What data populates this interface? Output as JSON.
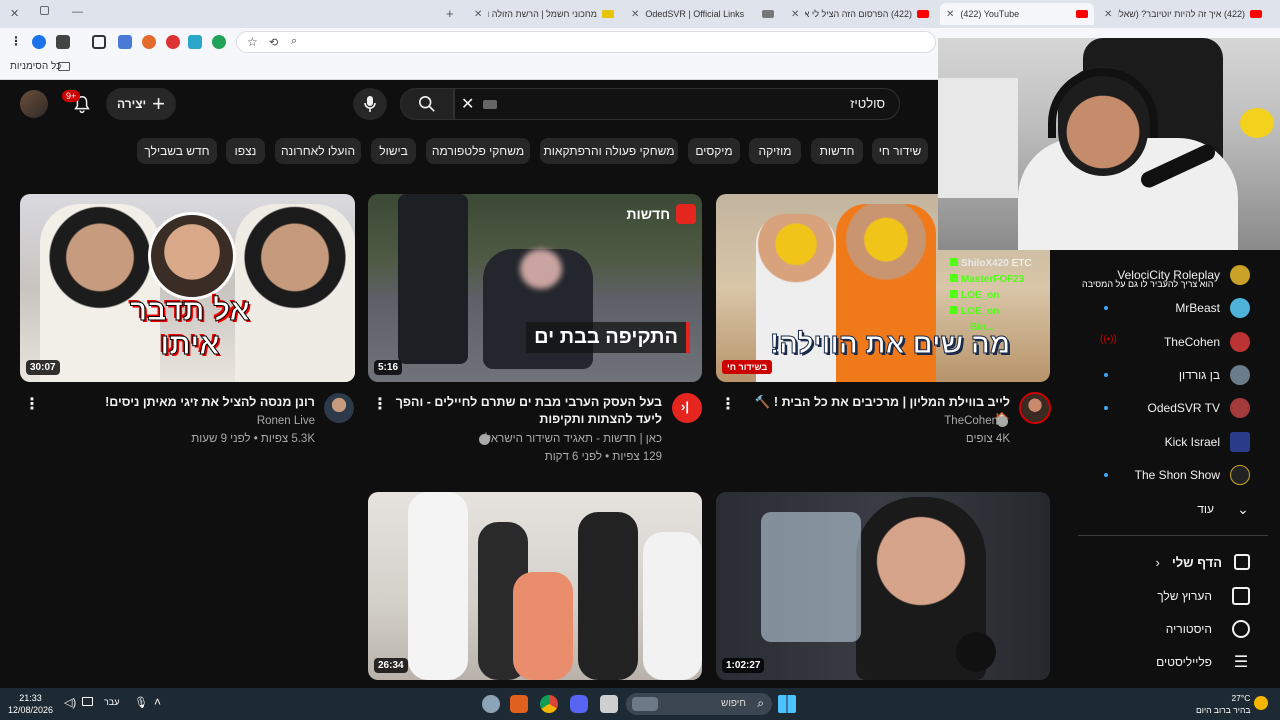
{
  "browser": {
    "tabs": [
      {
        "title": "(422) איך זה להיות יוטיובר? (שאלו..."
      },
      {
        "title": "(422) YouTube"
      },
      {
        "title": "(422) הפרסום הזה הציל לי את..."
      },
      {
        "title": "OdedSVR | Official Links"
      },
      {
        "title": "מחכוני חשמל | הרשת הזולה והוותיקה"
      }
    ],
    "bookmarks_label": "כל הסימניות"
  },
  "youtube": {
    "search_value": "סולטיז",
    "create_label": "יצירה",
    "notif_count": "9+",
    "chips": [
      "שידור חי",
      "חדשות",
      "מוזיקה",
      "מיקסים",
      "משחקי פעולה והרפתקאות",
      "משחקי פלטפורמה",
      "בישול",
      "הועלו לאחרונה",
      "נצפו",
      "חדש בשבילך"
    ],
    "videos": [
      {
        "thumb_text": "אל תדבר איתו",
        "duration": "30:07",
        "title": "רונן מנסה להציל את זיגי מאיתן ניסים!",
        "channel": "Ronen Live",
        "meta": "5.3K צפיות • לפני 9 שעות"
      },
      {
        "thumb_text": "התקיפה בבת ים",
        "badge": "חדשות",
        "duration": "5:16",
        "title": "בעל העסק הערבי מבת ים שתרם לחיילים - והפך ליעד להצתות ותקיפות",
        "channel": "כאן | חדשות - תאגיד השידור הישראלי",
        "meta": "129 צפיות • לפני 6 דקות"
      },
      {
        "thumb_text": "מה שים את הווילה!",
        "live_badge": "בשידור חי",
        "title": "לייב בווילת המליון | מרכיבים את כל הבית ! 🔨🏠",
        "channel": "TheCohen",
        "meta": "4K צופים"
      },
      {
        "duration": "26:34"
      },
      {
        "duration": "1:02:27"
      }
    ],
    "chat_overlay": [
      {
        "user": "ShiloX420",
        "text": "ETC"
      },
      {
        "user": "MasterFOF23",
        "text": "הוא צריך להעביר לו גם על המסיבה"
      },
      {
        "user": "LOE_on",
        "text": ""
      },
      {
        "user": "LOE_on",
        "text": ""
      },
      {
        "user": "Bin...",
        "text": ""
      }
    ],
    "sidebar": {
      "subscriptions": [
        {
          "name": "VelociCity Roleplay",
          "color": "#c9a227",
          "live": false,
          "dot": false
        },
        {
          "name": "MrBeast",
          "color": "#4fb3d9",
          "live": false,
          "dot": true
        },
        {
          "name": "TheCohen",
          "color": "#b33",
          "live": true,
          "dot": false
        },
        {
          "name": "בן גורדון",
          "color": "#6b7c8a",
          "live": false,
          "dot": true
        },
        {
          "name": "OdedSVR TV",
          "color": "#a33b3b",
          "live": false,
          "dot": true
        },
        {
          "name": "Kick Israel",
          "color": "#2b3d8a",
          "live": false,
          "dot": false
        },
        {
          "name": "The Shon Show",
          "color": "#222",
          "live": false,
          "dot": true
        }
      ],
      "more_label": "עוד",
      "you_header": "הדף שלי",
      "you_items": [
        "הערוץ שלך",
        "היסטוריה",
        "פלייליסטים"
      ]
    }
  },
  "taskbar": {
    "time": "21:33",
    "date": "12/08/2026",
    "lang": "עבר",
    "search_placeholder": "חיפוש",
    "weather_temp": "27°C",
    "weather_desc": "בהיר ברוב היום"
  }
}
